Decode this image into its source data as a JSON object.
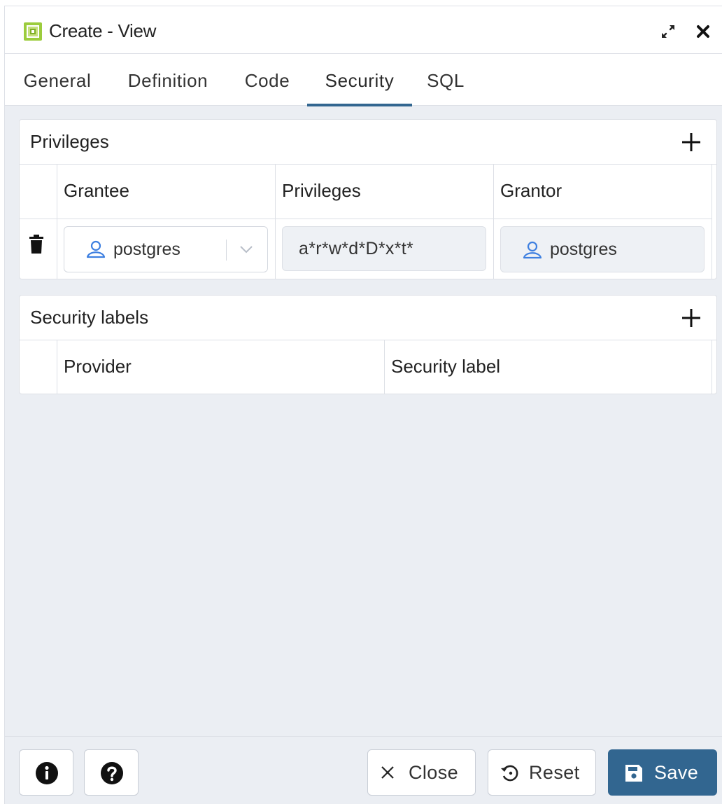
{
  "window": {
    "title": "Create - View",
    "icon": "view-icon",
    "accent": "#326690"
  },
  "tabs": [
    {
      "label": "General"
    },
    {
      "label": "Definition"
    },
    {
      "label": "Code"
    },
    {
      "label": "Security",
      "active": true
    },
    {
      "label": "SQL"
    }
  ],
  "privileges": {
    "title": "Privileges",
    "columns": [
      "Grantee",
      "Privileges",
      "Grantor"
    ],
    "rows": [
      {
        "grantee": "postgres",
        "privileges": "a*r*w*d*D*x*t*",
        "grantor": "postgres"
      }
    ]
  },
  "security_labels": {
    "title": "Security labels",
    "columns": [
      "Provider",
      "Security label"
    ]
  },
  "footer": {
    "info_icon": "info-icon",
    "help_icon": "help-icon",
    "close_label": "Close",
    "reset_label": "Reset",
    "save_label": "Save"
  }
}
